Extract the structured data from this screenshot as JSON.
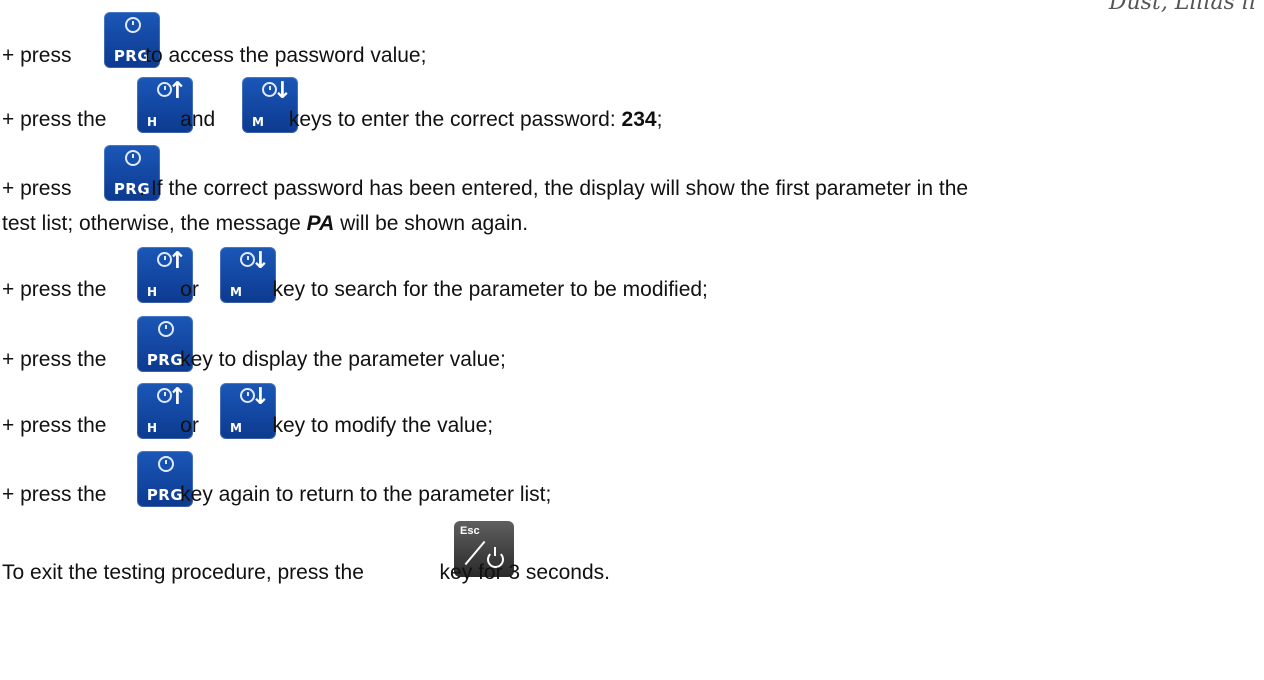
{
  "corner": "Dust, Lillas li",
  "step1": {
    "pre": "+ press ",
    "post": " to access the password value;"
  },
  "step2": {
    "pre": "+ press the ",
    "mid": " and ",
    "post_a": " keys to enter the correct password: ",
    "code": "234",
    "post_b": ";"
  },
  "step3": {
    "pre": "+ press ",
    "post_a": ". If the correct password has been entered, the display will show the first parameter in the",
    "line2a": "test list; otherwise, the message ",
    "msg": "PA",
    "line2b": " will be shown again."
  },
  "step4": {
    "pre": "+ press the ",
    "mid": " or ",
    "post": " key to search for the parameter to be modified;"
  },
  "step5": {
    "pre": "+ press the ",
    "post": " key to display the parameter value;"
  },
  "step6": {
    "pre": "+ press the ",
    "mid": " or ",
    "post": " key to modify the value;"
  },
  "step7": {
    "pre": "+ press the ",
    "post": " key again to return to the parameter list;"
  },
  "exit": {
    "pre": "To exit the testing procedure, press the ",
    "post": " key for 3 seconds."
  },
  "keys": {
    "prg_label": "PRG",
    "h_label": "H",
    "m_label": "M",
    "esc_label": "Esc",
    "up_arrow": "↑",
    "down_arrow": "↓"
  }
}
